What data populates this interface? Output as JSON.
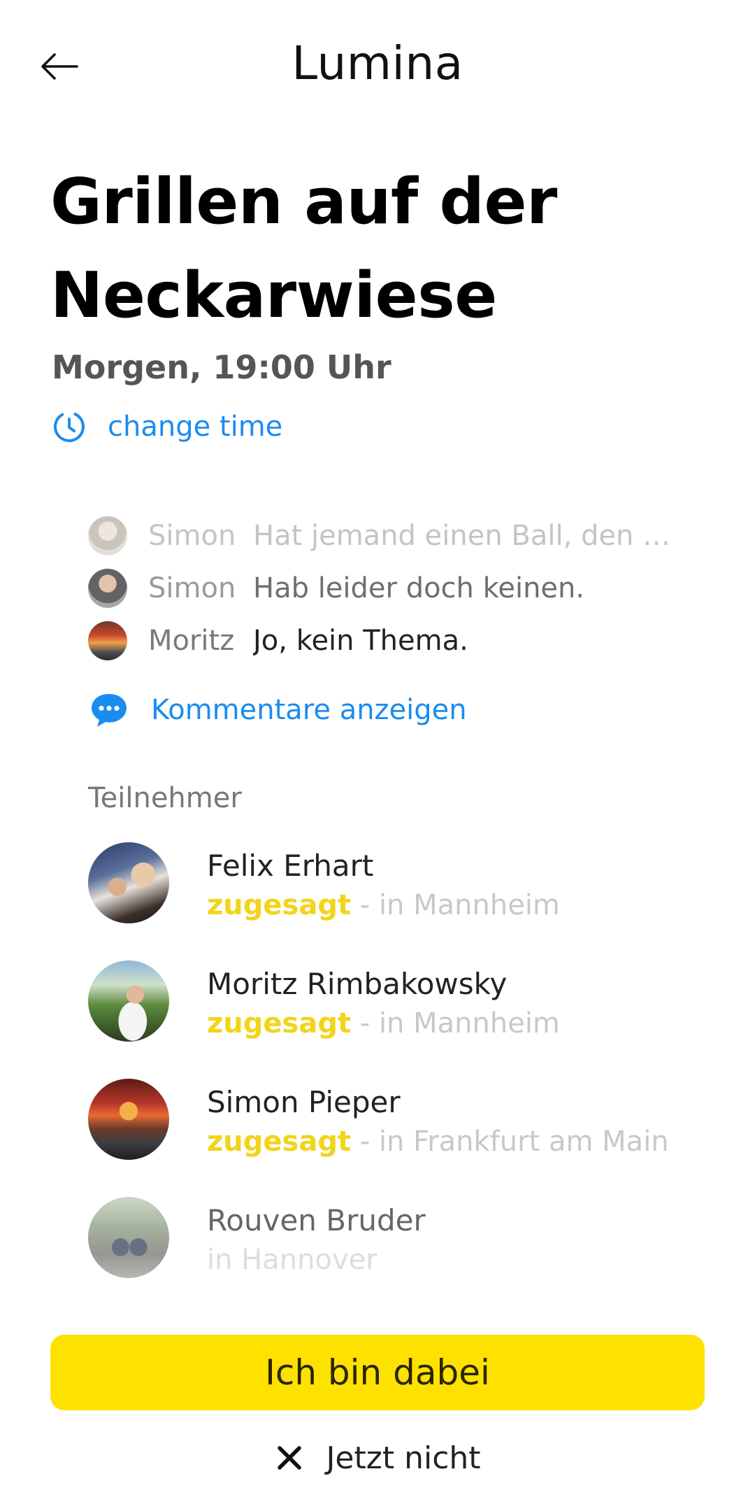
{
  "header": {
    "back_icon": "arrow-left-icon",
    "title": "Lumina"
  },
  "event": {
    "title": "Grillen auf der Neckarwiese",
    "time": "Morgen, 19:00 Uhr",
    "change_time_label": "change time",
    "change_time_icon": "clock-icon",
    "accent_color": "#1a8cf0"
  },
  "comments": {
    "items": [
      {
        "author": "Simon",
        "text": "Hat jemand einen Ball, den er…"
      },
      {
        "author": "Simon",
        "text": "Hab leider doch keinen."
      },
      {
        "author": "Moritz",
        "text": "Jo, kein Thema."
      }
    ],
    "show_comments_label": "Kommentare anzeigen",
    "show_comments_icon": "speech-bubble-icon"
  },
  "participants": {
    "heading": "Teilnehmer",
    "items": [
      {
        "name": "Felix Erhart",
        "status": "zugesagt",
        "location": "- in Mannheim"
      },
      {
        "name": "Moritz Rimbakowsky",
        "status": "zugesagt",
        "location": "- in Mannheim"
      },
      {
        "name": "Simon Pieper",
        "status": "zugesagt",
        "location": "- in Frankfurt am Main"
      },
      {
        "name": "Rouven Bruder",
        "status": "",
        "location": "in Hannover"
      }
    ],
    "accepted_color": "#f2d41a"
  },
  "actions": {
    "join_label": "Ich bin dabei",
    "join_color": "#fde200",
    "not_now_label": "Jetzt nicht",
    "not_now_icon": "close-icon"
  }
}
